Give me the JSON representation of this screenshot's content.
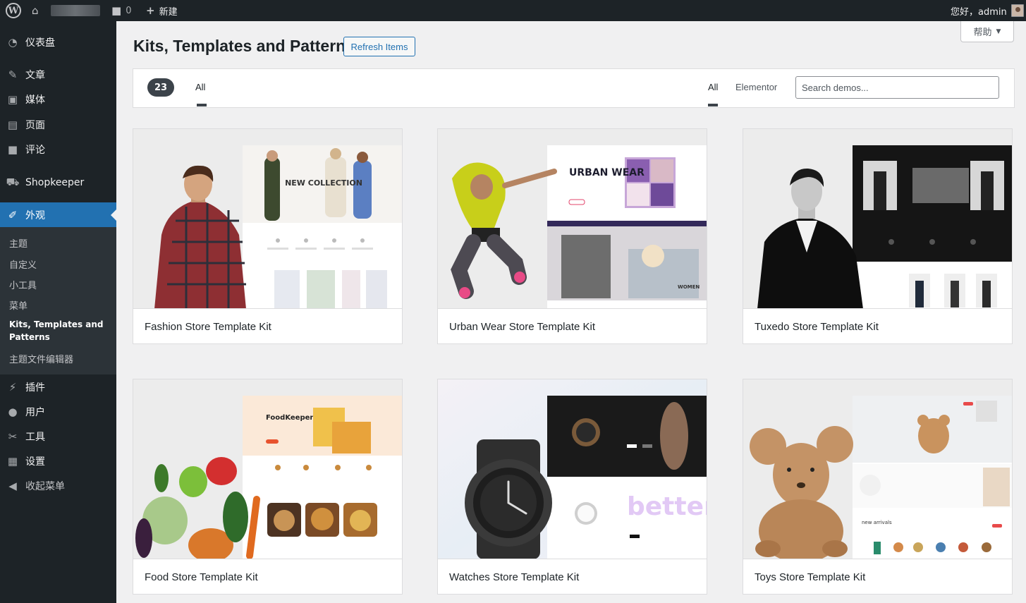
{
  "adminbar": {
    "comments_count": "0",
    "new_label": "新建",
    "greeting": "您好，admin"
  },
  "sidebar": {
    "items": [
      {
        "label": "仪表盘",
        "icon": "dashboard-icon"
      },
      {
        "label": "文章",
        "icon": "pin-icon"
      },
      {
        "label": "媒体",
        "icon": "media-icon"
      },
      {
        "label": "页面",
        "icon": "pages-icon"
      },
      {
        "label": "评论",
        "icon": "comments-icon"
      },
      {
        "label": "Shopkeeper",
        "icon": "cart-icon"
      },
      {
        "label": "外观",
        "icon": "appearance-icon"
      },
      {
        "label": "插件",
        "icon": "plugins-icon"
      },
      {
        "label": "用户",
        "icon": "users-icon"
      },
      {
        "label": "工具",
        "icon": "tools-icon"
      },
      {
        "label": "设置",
        "icon": "settings-icon"
      },
      {
        "label": "收起菜单",
        "icon": "collapse-icon"
      }
    ],
    "submenu": [
      "主题",
      "自定义",
      "小工具",
      "菜单",
      "Kits, Templates and Patterns",
      "主题文件编辑器"
    ]
  },
  "header": {
    "title": "Kits, Templates and Patterns",
    "refresh_label": "Refresh Items",
    "help_label": "帮助"
  },
  "filters": {
    "count": "23",
    "left_tab": "All",
    "right_tabs": [
      "All",
      "Elementor"
    ],
    "search_placeholder": "Search demos..."
  },
  "kits": [
    {
      "title": "Fashion Store Template Kit"
    },
    {
      "title": "Urban Wear Store Template Kit"
    },
    {
      "title": "Tuxedo Store Template Kit"
    },
    {
      "title": "Food Store Template Kit"
    },
    {
      "title": "Watches Store Template Kit"
    },
    {
      "title": "Toys Store Template Kit"
    }
  ],
  "thumb_text": {
    "fashion": "NEW COLLECTION",
    "urban": "URBAN WEAR",
    "urban_women": "WOMEN",
    "food": "FoodKeeper",
    "watches": "better",
    "toys": "new arrivals"
  },
  "colors": {
    "admin_dark": "#1d2327",
    "accent": "#2271b1"
  }
}
